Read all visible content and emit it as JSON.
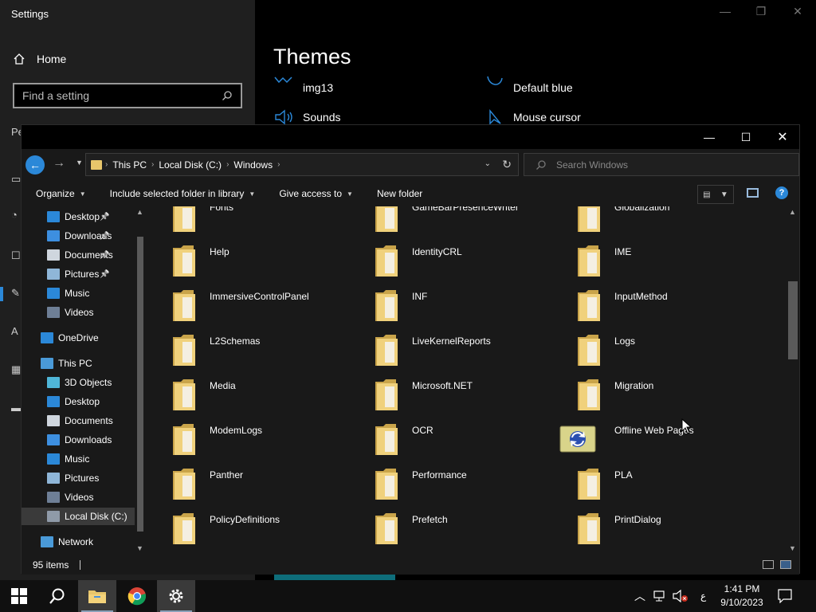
{
  "settings": {
    "title": "Settings",
    "home_label": "Home",
    "search_placeholder": "Find a setting",
    "side_letters": [
      "Pe",
      "A"
    ],
    "page_title": "Themes",
    "items": [
      {
        "label": "",
        "sub": "img13"
      },
      {
        "label": "",
        "sub": "Default blue"
      },
      {
        "label": "Sounds",
        "sub": ""
      },
      {
        "label": "Mouse cursor",
        "sub": ""
      }
    ]
  },
  "explorer": {
    "breadcrumb": [
      "This PC",
      "Local Disk (C:)",
      "Windows"
    ],
    "search_placeholder": "Search Windows",
    "toolbar": {
      "organize": "Organize",
      "include": "Include selected folder in library",
      "give_access": "Give access to",
      "new_folder": "New folder"
    },
    "nav": {
      "quick": [
        {
          "label": "Desktop",
          "pinned": true,
          "color": "#2b88d8"
        },
        {
          "label": "Downloads",
          "pinned": true,
          "color": "#3d8fe0"
        },
        {
          "label": "Documents",
          "pinned": true,
          "color": "#cfd6de"
        },
        {
          "label": "Pictures",
          "pinned": true,
          "color": "#8fb6d8"
        },
        {
          "label": "Music",
          "pinned": false,
          "color": "#2b88d8"
        },
        {
          "label": "Videos",
          "pinned": false,
          "color": "#6e7f96"
        }
      ],
      "onedrive": "OneDrive",
      "thispc": "This PC",
      "pc_items": [
        "3D Objects",
        "Desktop",
        "Documents",
        "Downloads",
        "Music",
        "Pictures",
        "Videos",
        "Local Disk (C:)"
      ],
      "network": "Network"
    },
    "folders": [
      [
        "Fonts",
        "GameBarPresenceWriter",
        "Globalization"
      ],
      [
        "Help",
        "IdentityCRL",
        "IME"
      ],
      [
        "ImmersiveControlPanel",
        "INF",
        "InputMethod"
      ],
      [
        "L2Schemas",
        "LiveKernelReports",
        "Logs"
      ],
      [
        "Media",
        "Microsoft.NET",
        "Migration"
      ],
      [
        "ModemLogs",
        "OCR",
        "Offline Web Pages"
      ],
      [
        "Panther",
        "Performance",
        "PLA"
      ],
      [
        "PolicyDefinitions",
        "Prefetch",
        "PrintDialog"
      ]
    ],
    "status": {
      "count": "95 items"
    }
  },
  "taskbar": {
    "time": "1:41 PM",
    "date": "9/10/2023",
    "ime": "ع"
  },
  "colors": {
    "accent": "#2b88d8",
    "folder": "#e8c66b"
  }
}
